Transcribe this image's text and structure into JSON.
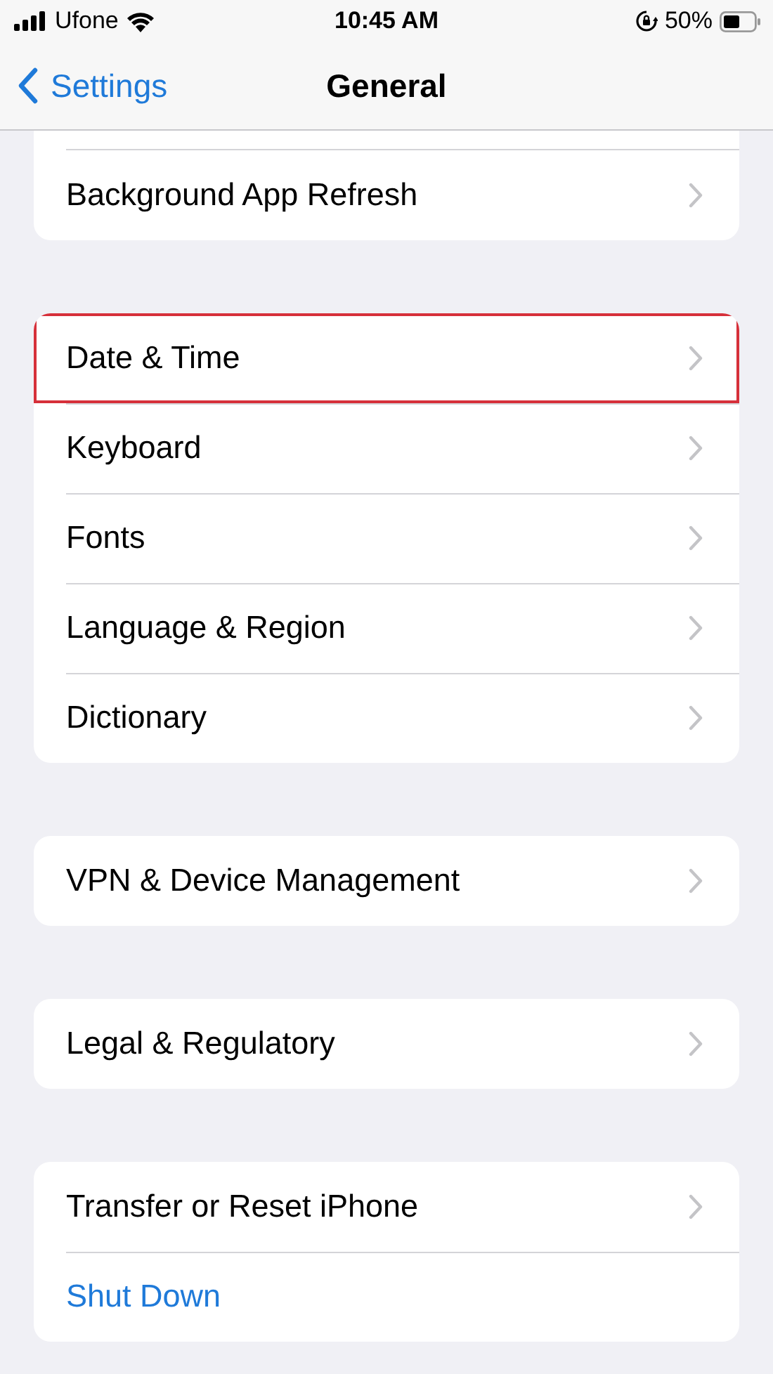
{
  "status_bar": {
    "carrier": "Ufone",
    "time": "10:45 AM",
    "battery": "50%"
  },
  "nav": {
    "back": "Settings",
    "title": "General"
  },
  "groups": [
    {
      "rows": [
        {
          "label": "Background App Refresh",
          "kind": "link",
          "highlighted": false
        }
      ]
    },
    {
      "rows": [
        {
          "label": "Date & Time",
          "kind": "link",
          "highlighted": true
        },
        {
          "label": "Keyboard",
          "kind": "link",
          "highlighted": false
        },
        {
          "label": "Fonts",
          "kind": "link",
          "highlighted": false
        },
        {
          "label": "Language & Region",
          "kind": "link",
          "highlighted": false
        },
        {
          "label": "Dictionary",
          "kind": "link",
          "highlighted": false
        }
      ]
    },
    {
      "rows": [
        {
          "label": "VPN & Device Management",
          "kind": "link",
          "highlighted": false
        }
      ]
    },
    {
      "rows": [
        {
          "label": "Legal & Regulatory",
          "kind": "link",
          "highlighted": false
        }
      ]
    },
    {
      "rows": [
        {
          "label": "Transfer or Reset iPhone",
          "kind": "link",
          "highlighted": false
        },
        {
          "label": "Shut Down",
          "kind": "action",
          "highlighted": false
        }
      ]
    }
  ]
}
